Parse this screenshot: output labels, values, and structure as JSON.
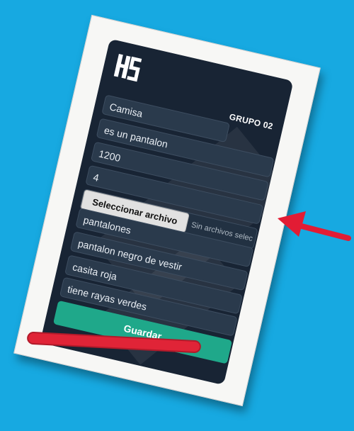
{
  "header": {
    "group_label": "GRUPO 02"
  },
  "form": {
    "fields": [
      {
        "value": "Camisa"
      },
      {
        "value": "es un pantalon"
      },
      {
        "value": "1200"
      },
      {
        "value": "4"
      }
    ],
    "file_input": {
      "button_label": "Seleccionar archivo",
      "status_text": "Sin archivos selec"
    },
    "list_items": [
      {
        "value": "pantalones"
      },
      {
        "value": "pantalon negro de vestir"
      },
      {
        "value": "casita roja"
      },
      {
        "value": "tiene rayas verdes"
      }
    ],
    "save_label": "Guardar"
  },
  "colors": {
    "background": "#17a9e1",
    "panel": "#182434",
    "save_button": "#1fa88a",
    "annotation_arrow": "#e21c34",
    "annotation_bar": "#e02437"
  },
  "icons": {
    "logo": "hs-logo-icon",
    "annotation": "red-arrow-icon"
  }
}
